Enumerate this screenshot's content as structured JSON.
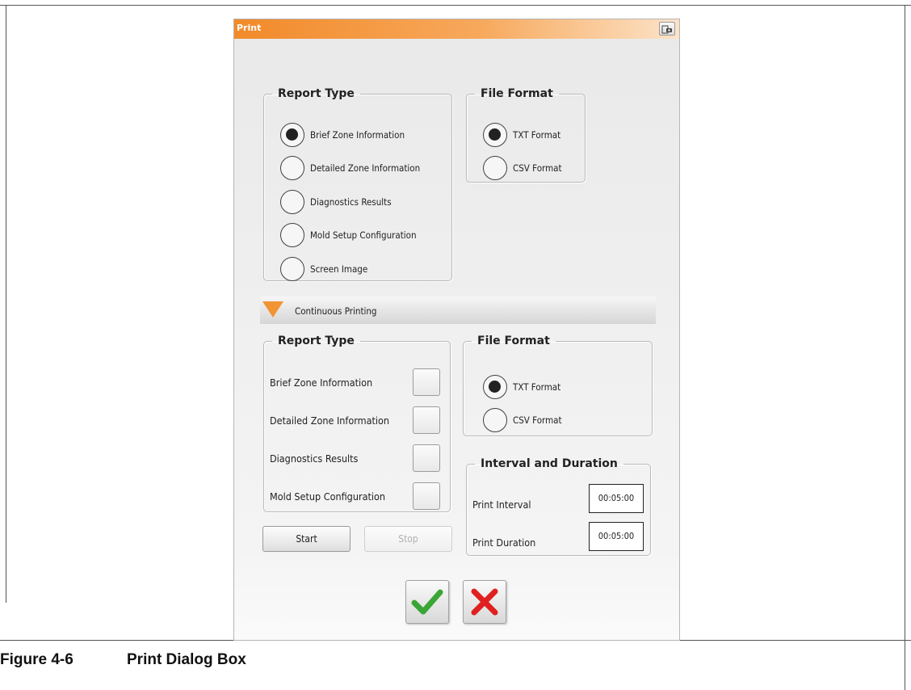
{
  "dialog": {
    "title": "Print",
    "titlebar_icon": "screenshot-camera-icon"
  },
  "top": {
    "report_type": {
      "legend": "Report Type",
      "options": [
        {
          "label": "Brief Zone Information",
          "selected": true
        },
        {
          "label": "Detailed Zone Information",
          "selected": false
        },
        {
          "label": "Diagnostics Results",
          "selected": false
        },
        {
          "label": "Mold Setup Configuration",
          "selected": false
        },
        {
          "label": "Screen Image",
          "selected": false
        }
      ]
    },
    "file_format": {
      "legend": "File Format",
      "options": [
        {
          "label": "TXT Format",
          "selected": true
        },
        {
          "label": "CSV Format",
          "selected": false
        }
      ]
    }
  },
  "continuous": {
    "header_label": "Continuous Printing",
    "expanded": true,
    "report_type": {
      "legend": "Report Type",
      "options": [
        {
          "label": "Brief Zone Information",
          "checked": false
        },
        {
          "label": "Detailed Zone Information",
          "checked": false
        },
        {
          "label": "Diagnostics Results",
          "checked": false
        },
        {
          "label": "Mold Setup Configuration",
          "checked": false
        }
      ]
    },
    "file_format": {
      "legend": "File Format",
      "options": [
        {
          "label": "TXT Format",
          "selected": true
        },
        {
          "label": "CSV Format",
          "selected": false
        }
      ]
    },
    "interval_duration": {
      "legend": "Interval and Duration",
      "print_interval_label": "Print Interval",
      "print_interval_value": "00:05:00",
      "print_duration_label": "Print Duration",
      "print_duration_value": "00:05:00"
    },
    "start_label": "Start",
    "stop_label": "Stop",
    "stop_enabled": false
  },
  "actions": {
    "ok_icon": "checkmark-icon",
    "ok_color": "#3aa635",
    "cancel_icon": "close-x-icon",
    "cancel_color": "#e02020"
  },
  "caption": {
    "number": "Figure 4-6",
    "title": "Print Dialog Box"
  },
  "colors": {
    "titlebar_accent": "#f28a2a",
    "expand_triangle": "#f29433"
  }
}
